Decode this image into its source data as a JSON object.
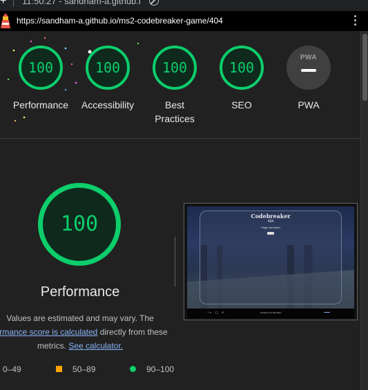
{
  "browser": {
    "tab_text": "11:50:27 - sandham-a.github.i",
    "url": "https://sandham-a.github.io/ms2-codebreaker-game/404"
  },
  "summary": {
    "gauges": [
      {
        "score": "100",
        "label": "Performance"
      },
      {
        "score": "100",
        "label": "Accessibility"
      },
      {
        "score": "100",
        "label": "Best Practices"
      },
      {
        "score": "100",
        "label": "SEO"
      }
    ],
    "pwa": {
      "badge": "PWA",
      "label": "PWA"
    }
  },
  "performance": {
    "score": "100",
    "title": "Performance",
    "note_prefix": "Values are estimated and may vary. The",
    "note_link": "formance score is calculated",
    "note_middle": "directly from these metrics.",
    "calc_link": "See calculator."
  },
  "thumbnail": {
    "title": "Codebreaker",
    "code": "404",
    "message": "Page not found",
    "footer_credit": "Created by S.Sandham"
  },
  "legend": {
    "fail": "0–49",
    "average": "50–89",
    "pass": "90–100"
  },
  "colors": {
    "pass": "#0cce6b",
    "average": "#ffa400",
    "link": "#8ab4f8"
  }
}
